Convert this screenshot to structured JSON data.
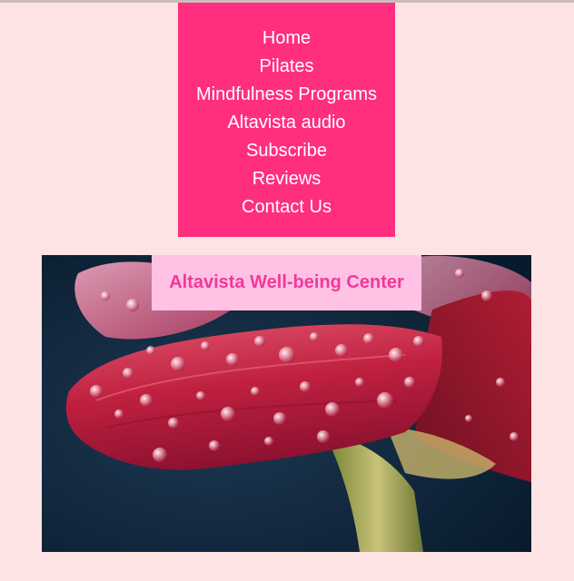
{
  "nav": {
    "items": [
      {
        "label": "Home"
      },
      {
        "label": "Pilates"
      },
      {
        "label": "Mindfulness Programs"
      },
      {
        "label": "Altavista audio"
      },
      {
        "label": "Subscribe"
      },
      {
        "label": "Reviews"
      },
      {
        "label": "Contact Us"
      }
    ]
  },
  "hero": {
    "title": "Altavista Well-being Center"
  },
  "colors": {
    "page_background": "#fde3e3",
    "nav_background": "#ff2e7e",
    "nav_text": "#ffffff",
    "title_box_background": "#ffc2e4",
    "title_text": "#f0399a"
  }
}
